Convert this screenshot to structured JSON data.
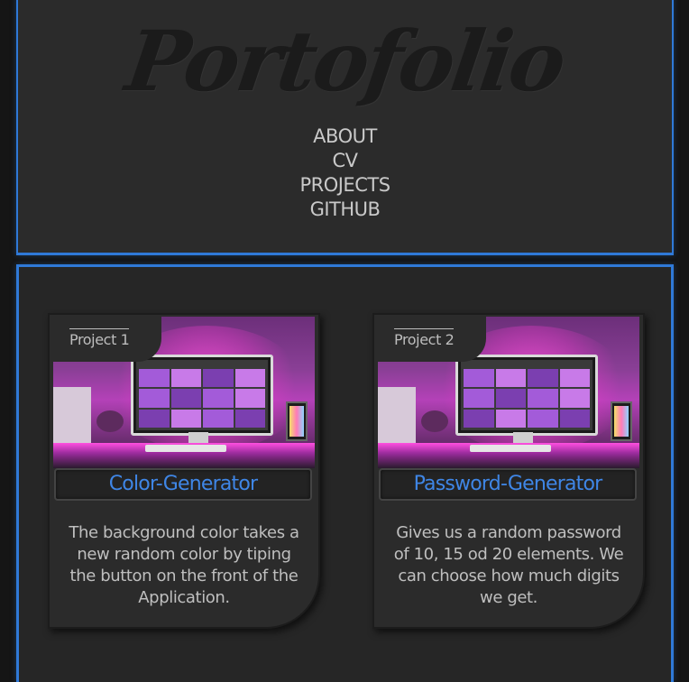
{
  "header": {
    "logo": "Portofolio",
    "nav": [
      "ABOUT",
      "CV",
      "PROJECTS",
      "GITHUB"
    ]
  },
  "projects": [
    {
      "tag": "Project 1",
      "title": "Color-Generator",
      "description": "The background color takes a new random color by tiping the button on the front of the Application."
    },
    {
      "tag": "Project 2",
      "title": "Password-Generator",
      "description": "Gives us a random password of 10, 15 od 20 elements. We can choose how much digits we get."
    }
  ],
  "colors": {
    "accent": "#2f79d8",
    "title": "#3f86e6",
    "background": "#151515",
    "panel": "#2b2b2b"
  }
}
